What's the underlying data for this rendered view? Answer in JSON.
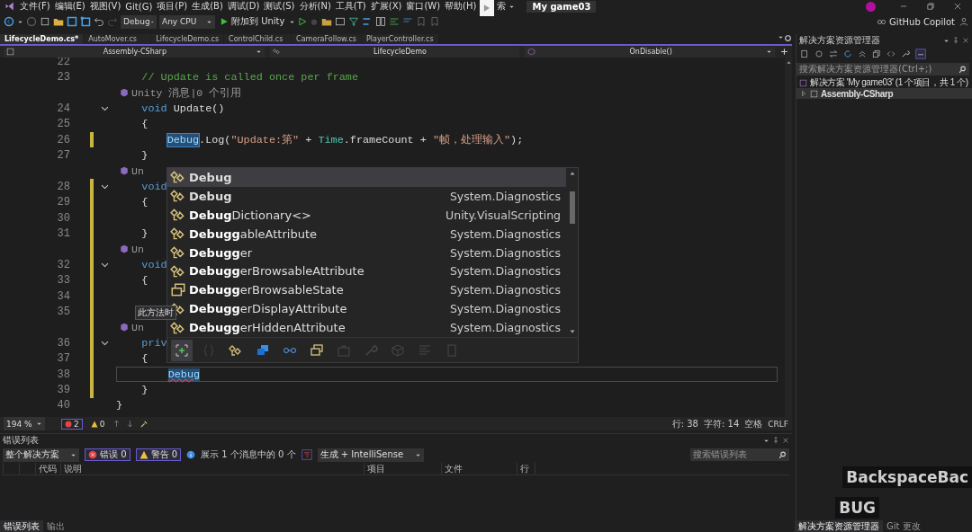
{
  "menu_bar": {
    "items": [
      "文件(F)",
      "编辑(E)",
      "视图(V)",
      "Git(G)",
      "项目(P)",
      "生成(B)",
      "调试(D)",
      "测试(S)",
      "分析(N)",
      "工具(T)",
      "扩展(X)",
      "窗口(W)",
      "帮助(H)"
    ],
    "search_fragment": "索",
    "title": "My game03"
  },
  "toolbar": {
    "configuration": "Debug",
    "platform": "Any CPU",
    "run_target": "附加到 Unity",
    "copilot": "GitHub Copilot"
  },
  "editor": {
    "tabs": [
      {
        "label": "LifecycleDemo.cs*",
        "selected": true
      },
      {
        "label": "AutoMover.cs",
        "selected": false
      },
      {
        "label": "LifecycleDemo.cs",
        "selected": false
      },
      {
        "label": "ControlChild.cs",
        "selected": false
      },
      {
        "label": "CameraFollow.cs",
        "selected": false
      },
      {
        "label": "PlayerController.cs",
        "selected": false
      }
    ],
    "navigation": {
      "project": "Assembly-CSharp",
      "type": "LifecycleDemo",
      "member": "OnDisable()"
    },
    "lines": [
      {
        "kind": "code",
        "number": "22",
        "modified": false,
        "fold": false,
        "current": false
      },
      {
        "kind": "code",
        "number": "23",
        "modified": false,
        "fold": false,
        "current": false,
        "tokens": [
          {
            "kind": "comment",
            "text": "    // Update is called once per frame"
          }
        ]
      },
      {
        "kind": "lens",
        "modified": false,
        "text": "Unity 消息|0 个引用"
      },
      {
        "kind": "code",
        "number": "24",
        "modified": false,
        "fold": true,
        "current": false,
        "tokens": [
          {
            "kind": "keyword",
            "text": "    void"
          },
          {
            "kind": "plain",
            "text": " Update()"
          }
        ]
      },
      {
        "kind": "code",
        "number": "25",
        "modified": false,
        "fold": false,
        "current": false,
        "tokens": [
          {
            "kind": "plain",
            "text": "    {"
          }
        ]
      },
      {
        "kind": "code",
        "number": "26",
        "modified": true,
        "fold": false,
        "current": false,
        "tokens": [
          {
            "kind": "reference",
            "text": "        Debug"
          },
          {
            "kind": "plain",
            "text": ".Log("
          },
          {
            "kind": "string",
            "text": "\"Update:第\""
          },
          {
            "kind": "plain",
            "text": " + "
          },
          {
            "kind": "type",
            "text": "Time"
          },
          {
            "kind": "plain",
            "text": ".frameCount + "
          },
          {
            "kind": "string",
            "text": "\"帧，处理输入\""
          },
          {
            "kind": "plain",
            "text": ");"
          }
        ]
      },
      {
        "kind": "code",
        "number": "27",
        "modified": false,
        "fold": false,
        "current": false,
        "tokens": [
          {
            "kind": "plain",
            "text": "    }"
          }
        ]
      },
      {
        "kind": "lens",
        "modified": false,
        "text": "Un"
      },
      {
        "kind": "code",
        "number": "28",
        "modified": true,
        "fold": true,
        "current": false,
        "tokens": [
          {
            "kind": "keyword",
            "text": "    void"
          }
        ]
      },
      {
        "kind": "code",
        "number": "29",
        "modified": true,
        "fold": false,
        "current": false,
        "tokens": [
          {
            "kind": "plain",
            "text": "    {"
          }
        ]
      },
      {
        "kind": "code",
        "number": "30",
        "modified": true,
        "fold": false,
        "current": false
      },
      {
        "kind": "code",
        "number": "31",
        "modified": true,
        "fold": false,
        "current": false,
        "tokens": [
          {
            "kind": "plain",
            "text": "    }"
          }
        ]
      },
      {
        "kind": "lens",
        "modified": true,
        "text": "Un"
      },
      {
        "kind": "code",
        "number": "32",
        "modified": true,
        "fold": true,
        "current": false,
        "tokens": [
          {
            "kind": "keyword",
            "text": "    void"
          }
        ]
      },
      {
        "kind": "code",
        "number": "33",
        "modified": true,
        "fold": false,
        "current": false,
        "tokens": [
          {
            "kind": "plain",
            "text": "    {"
          }
        ]
      },
      {
        "kind": "code",
        "number": "34",
        "modified": true,
        "fold": false,
        "current": false
      },
      {
        "kind": "code",
        "number": "35",
        "modified": true,
        "fold": false,
        "current": false
      },
      {
        "kind": "lens",
        "modified": true,
        "text": "Un"
      },
      {
        "kind": "code",
        "number": "36",
        "modified": true,
        "fold": true,
        "current": false,
        "tokens": [
          {
            "kind": "keyword",
            "text": "    priv"
          }
        ]
      },
      {
        "kind": "code",
        "number": "37",
        "modified": true,
        "fold": false,
        "current": false,
        "tokens": [
          {
            "kind": "plain",
            "text": "    {"
          }
        ]
      },
      {
        "kind": "code",
        "number": "38",
        "modified": true,
        "fold": false,
        "current": true,
        "tokens": [
          {
            "kind": "selection",
            "text": "        Debug"
          }
        ]
      },
      {
        "kind": "code",
        "number": "39",
        "modified": true,
        "fold": false,
        "current": false,
        "tokens": [
          {
            "kind": "plain",
            "text": "    }"
          }
        ]
      },
      {
        "kind": "code",
        "number": "40",
        "modified": false,
        "fold": false,
        "current": false,
        "tokens": [
          {
            "kind": "plain",
            "text": "}"
          }
        ]
      }
    ],
    "tooltip": "此方法时",
    "completion": {
      "items": [
        {
          "name": "Debug",
          "exact": true,
          "kind": "class",
          "selected": true
        },
        {
          "name": "Debug",
          "exact": true,
          "kind": "class",
          "namespace": "System.Diagnostics",
          "selected": false
        },
        {
          "name": "**Debug**Dictionary<>",
          "exact": false,
          "kind": "class",
          "namespace": "Unity.VisualScripting",
          "selected": false
        },
        {
          "name": "**Debugg**ableAttribute",
          "exact": false,
          "kind": "class",
          "namespace": "System.Diagnostics",
          "selected": false
        },
        {
          "name": "**Debugg**er",
          "exact": false,
          "kind": "class",
          "namespace": "System.Diagnostics",
          "selected": false
        },
        {
          "name": "**Debugg**erBrowsableAttribute",
          "exact": false,
          "kind": "class",
          "namespace": "System.Diagnostics",
          "selected": false
        },
        {
          "name": "**Debugg**erBrowsableState",
          "exact": false,
          "kind": "enum",
          "namespace": "System.Diagnostics",
          "selected": false
        },
        {
          "name": "**Debugg**erDisplayAttribute",
          "exact": false,
          "kind": "class",
          "namespace": "System.Diagnostics",
          "selected": false
        },
        {
          "name": "**Debugg**erHiddenAttribute",
          "exact": false,
          "kind": "class",
          "namespace": "System.Diagnostics",
          "selected": false
        }
      ],
      "filters": [
        {
          "kind": "expand",
          "selected": true,
          "disabled": false
        },
        {
          "kind": "braces",
          "selected": false,
          "disabled": true
        },
        {
          "kind": "class",
          "selected": false,
          "disabled": false
        },
        {
          "kind": "interface",
          "selected": false,
          "disabled": false
        },
        {
          "kind": "delegate",
          "selected": false,
          "disabled": false
        },
        {
          "kind": "enum",
          "selected": false,
          "disabled": false
        },
        {
          "kind": "module",
          "selected": false,
          "disabled": true
        },
        {
          "kind": "property",
          "selected": false,
          "disabled": true
        },
        {
          "kind": "struct",
          "selected": false,
          "disabled": true
        },
        {
          "kind": "list",
          "selected": false,
          "disabled": true
        },
        {
          "kind": "page",
          "selected": false,
          "disabled": true
        }
      ]
    },
    "status": {
      "zoom": "194 %",
      "errors": "2",
      "warnings": "0",
      "line": "行: 38",
      "column": "字符: 14",
      "indent": "空格",
      "line_ending": "CRLF"
    }
  },
  "error_list": {
    "title": "错误列表",
    "scope": "整个解决方案",
    "errors_filter": {
      "label": "错误 0",
      "on": true
    },
    "warnings_filter": {
      "label": "警告 0",
      "on": true
    },
    "messages": "展示 1 个消息中的 0 个",
    "source": "生成 + IntelliSense",
    "search": {
      "placeholder": "搜索错误列表"
    },
    "columns": [
      "代码",
      "说明",
      "项目",
      "文件",
      "行"
    ]
  },
  "solution_explorer": {
    "title": "解决方案资源管理器",
    "search": {
      "placeholder": "搜索解决方案资源管理器(Ctrl+;)"
    },
    "tree": [
      {
        "label": "解决方案 'My game03' (1 个项目，共 1 个)",
        "selected": false,
        "children": [
          {
            "label": "Assembly-CSharp",
            "selected": true,
            "expanded": false
          }
        ]
      }
    ]
  },
  "bottom_tabs": {
    "left": [
      {
        "label": "错误列表",
        "selected": true
      },
      {
        "label": "输出",
        "selected": false
      }
    ],
    "right": [
      {
        "label": "解决方案资源管理器",
        "selected": true
      },
      {
        "label": "Git 更改",
        "selected": false
      }
    ]
  },
  "key_overlay": [
    "BackspaceBac",
    "BUG"
  ]
}
